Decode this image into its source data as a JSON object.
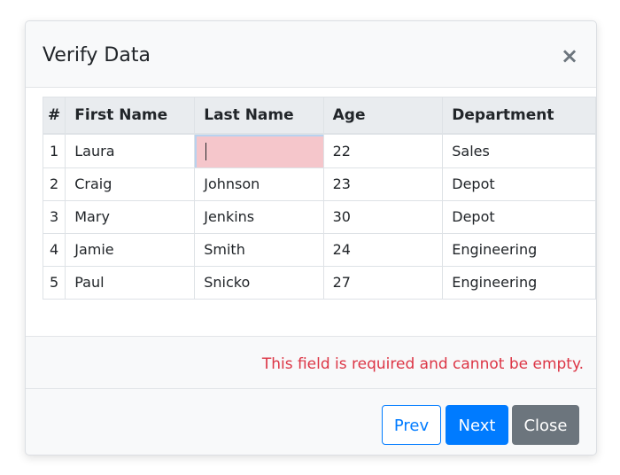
{
  "dialog": {
    "title": "Verify Data",
    "close_glyph": "×",
    "close_icon": "close-icon"
  },
  "table": {
    "columns": [
      "#",
      "First Name",
      "Last Name",
      "Age",
      "Department"
    ],
    "rows": [
      [
        "1",
        "Laura",
        "",
        "22",
        "Sales"
      ],
      [
        "2",
        "Craig",
        "Johnson",
        "23",
        "Depot"
      ],
      [
        "3",
        "Mary",
        "Jenkins",
        "30",
        "Depot"
      ],
      [
        "4",
        "Jamie",
        "Smith",
        "24",
        "Engineering"
      ],
      [
        "5",
        "Paul",
        "Snicko",
        "27",
        "Engineering"
      ]
    ],
    "editing_cell": {
      "row": 0,
      "col": 2
    }
  },
  "validation": {
    "message": "This field is required and cannot be empty."
  },
  "footer": {
    "prev_label": "Prev",
    "next_label": "Next",
    "close_label": "Close"
  },
  "colors": {
    "primary": "#007bff",
    "secondary": "#6c757d",
    "danger": "#dc3545",
    "invalid_cell": "#f5c6cb"
  }
}
